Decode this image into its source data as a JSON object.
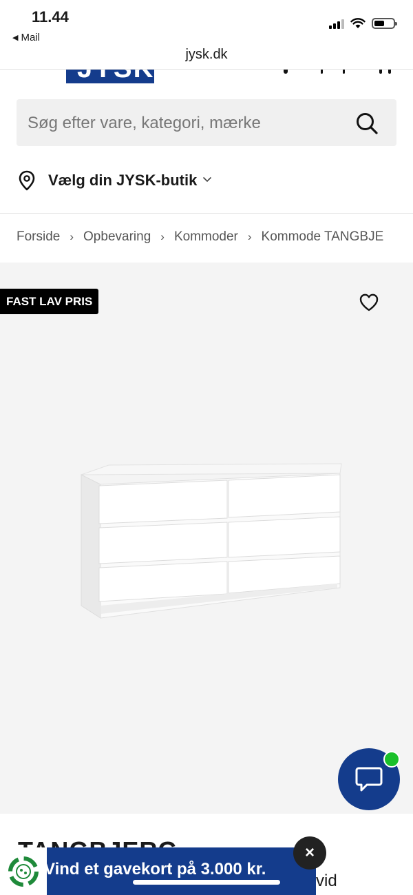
{
  "status_bar": {
    "time": "11.44",
    "back_app": "Mail",
    "url": "jysk.dk"
  },
  "header": {
    "logo_text": "JYSK"
  },
  "search": {
    "placeholder": "Søg efter vare, kategori, mærke",
    "icon": "search-icon"
  },
  "store": {
    "label": "Vælg din JYSK-butik",
    "icon": "location-pin-icon"
  },
  "breadcrumb": {
    "items": [
      "Forside",
      "Opbevaring",
      "Kommoder",
      "Kommode TANGBJE"
    ],
    "separator": "›"
  },
  "product": {
    "badge": "FAST LAV PRIS",
    "title_partial": "TANGBJERG",
    "visible_word": "vid"
  },
  "promo": {
    "text": "Vind et gavekort på 3.000 kr.",
    "close": "×"
  },
  "colors": {
    "brand_blue": "#143c8c",
    "online_green": "#1ac02a",
    "badge_black": "#000000"
  }
}
